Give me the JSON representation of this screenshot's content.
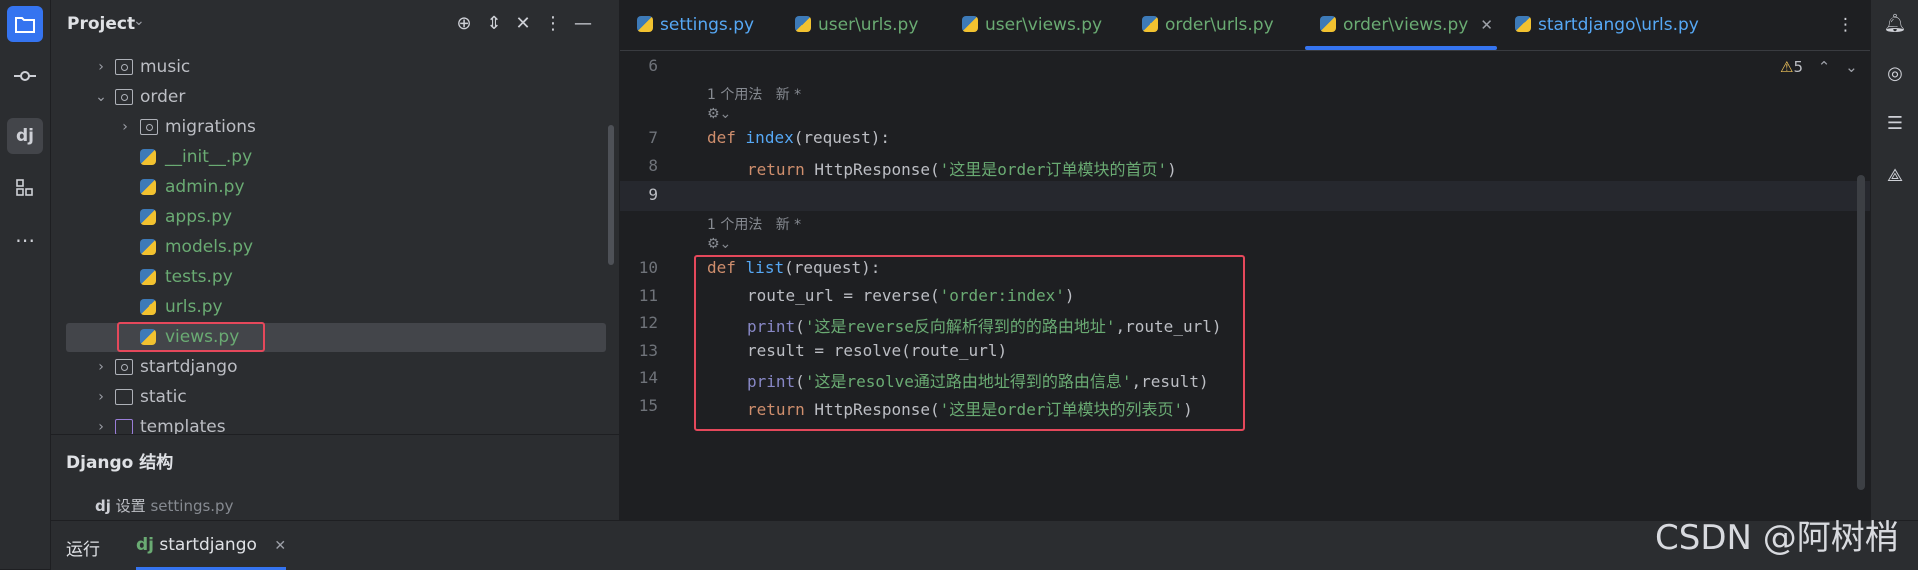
{
  "project_panel": {
    "title": "Project",
    "tree": [
      {
        "label": "music",
        "kind": "package",
        "expanded": false
      },
      {
        "label": "order",
        "kind": "package",
        "expanded": true
      },
      {
        "label": "migrations",
        "kind": "package",
        "expanded": false
      },
      {
        "label": "__init__.py",
        "kind": "python"
      },
      {
        "label": "admin.py",
        "kind": "python"
      },
      {
        "label": "apps.py",
        "kind": "python"
      },
      {
        "label": "models.py",
        "kind": "python"
      },
      {
        "label": "tests.py",
        "kind": "python"
      },
      {
        "label": "urls.py",
        "kind": "python"
      },
      {
        "label": "views.py",
        "kind": "python",
        "selected": true
      },
      {
        "label": "startdjango",
        "kind": "package",
        "expanded": false
      },
      {
        "label": "static",
        "kind": "folder",
        "expanded": false
      },
      {
        "label": "templates",
        "kind": "folder",
        "expanded": false
      }
    ]
  },
  "django_structure": {
    "title": "Django 结构",
    "settings_label": "设置",
    "settings_file": "settings.py"
  },
  "tabs": [
    {
      "label": "settings.py"
    },
    {
      "label": "user\\urls.py"
    },
    {
      "label": "user\\views.py"
    },
    {
      "label": "order\\urls.py"
    },
    {
      "label": "order\\views.py",
      "active": true
    },
    {
      "label": "startdjango\\urls.py"
    }
  ],
  "inspections": {
    "warnings_count": "5"
  },
  "code": {
    "line_numbers": [
      "6",
      "7",
      "8",
      "9",
      "10",
      "11",
      "12",
      "13",
      "14",
      "15"
    ],
    "hint_usage": "1 个用法",
    "hint_new": "新 *",
    "line7": {
      "kw": "def",
      "name": "index",
      "rest": "(request):"
    },
    "line8": {
      "kw": "return",
      "call": " HttpResponse(",
      "str": "'这里是order订单模块的首页'",
      "end": ")"
    },
    "line10": {
      "kw": "def",
      "name": "list",
      "rest": "(request):"
    },
    "line11": {
      "lhs": "route_url = reverse(",
      "str": "'order:index'",
      "end": ")"
    },
    "line12": {
      "bi": "print",
      "open": "(",
      "str": "'这是reverse反向解析得到的的路由地址'",
      "end": ",route_url)"
    },
    "line13": {
      "text": "result = resolve(route_url)"
    },
    "line14": {
      "bi": "print",
      "open": "(",
      "str": "'这是resolve通过路由地址得到的路由信息'",
      "end": ",result)"
    },
    "line15": {
      "kw": "return",
      "call": " HttpResponse(",
      "str": "'这里是order订单模块的列表页'",
      "end": ")"
    }
  },
  "bottom_bar": {
    "run_label": "运行",
    "run_config": "startdjango"
  },
  "watermark": "CSDN @阿树梢",
  "colors": {
    "highlight_border": "#e5485b",
    "accent": "#3574f0",
    "keyword": "#cf8e6d",
    "function": "#56a8f5",
    "string": "#6aab73"
  }
}
